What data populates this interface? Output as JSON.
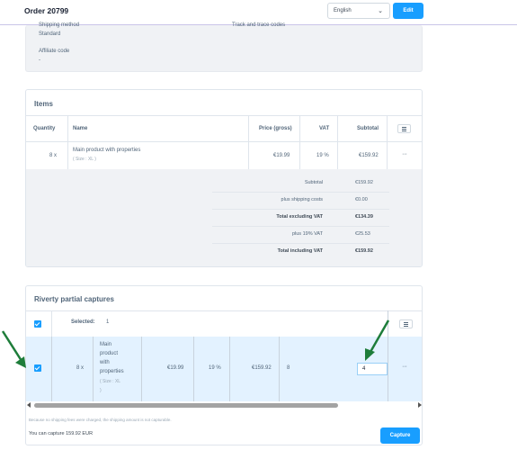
{
  "header": {
    "title": "Order 20799",
    "language": "English",
    "edit_label": "Edit"
  },
  "details": {
    "shipping_method_label": "Shipping method",
    "shipping_method_value": "Standard",
    "tracking_label": "Track and trace codes",
    "affiliate_label": "Affiliate code",
    "affiliate_value": "-"
  },
  "items": {
    "title": "Items",
    "columns": [
      "Quantity",
      "Name",
      "Price (gross)",
      "VAT",
      "Subtotal"
    ],
    "row": {
      "quantity": "8 x",
      "name": "Main product with properties",
      "properties": "( Size : XL )",
      "price": "€19.99",
      "vat": "19 %",
      "subtotal": "€159.92"
    },
    "summary": [
      {
        "label": "Subtotal",
        "value": "€159.92",
        "bold": false
      },
      {
        "label": "plus shipping costs",
        "value": "€0.00",
        "bold": false
      },
      {
        "label": "Total excluding VAT",
        "value": "€134.39",
        "bold": true
      },
      {
        "label": "plus 19% VAT",
        "value": "€25.53",
        "bold": false
      },
      {
        "label": "Total including VAT",
        "value": "€159.92",
        "bold": true
      }
    ]
  },
  "riverty": {
    "title": "Riverty partial captures",
    "selected_label": "Selected:",
    "selected_count": "1",
    "row": {
      "quantity": "8 x",
      "name_lines": [
        "Main",
        "product",
        "with",
        "properties"
      ],
      "properties_lines": [
        "( Size : XL",
        ")"
      ],
      "price": "€19.99",
      "vat": "19 %",
      "subtotal": "€159.92",
      "capturable": "8",
      "capture_qty": "4"
    },
    "note": "Because no shipping fees were charged, the shipping amount is not capturable.",
    "capture_info": "You can capture 159.92 EUR",
    "capture_label": "Capture"
  },
  "colors": {
    "accent": "#189eff",
    "arrow": "#1e7d3a",
    "selected_row": "#e3f2ff"
  }
}
